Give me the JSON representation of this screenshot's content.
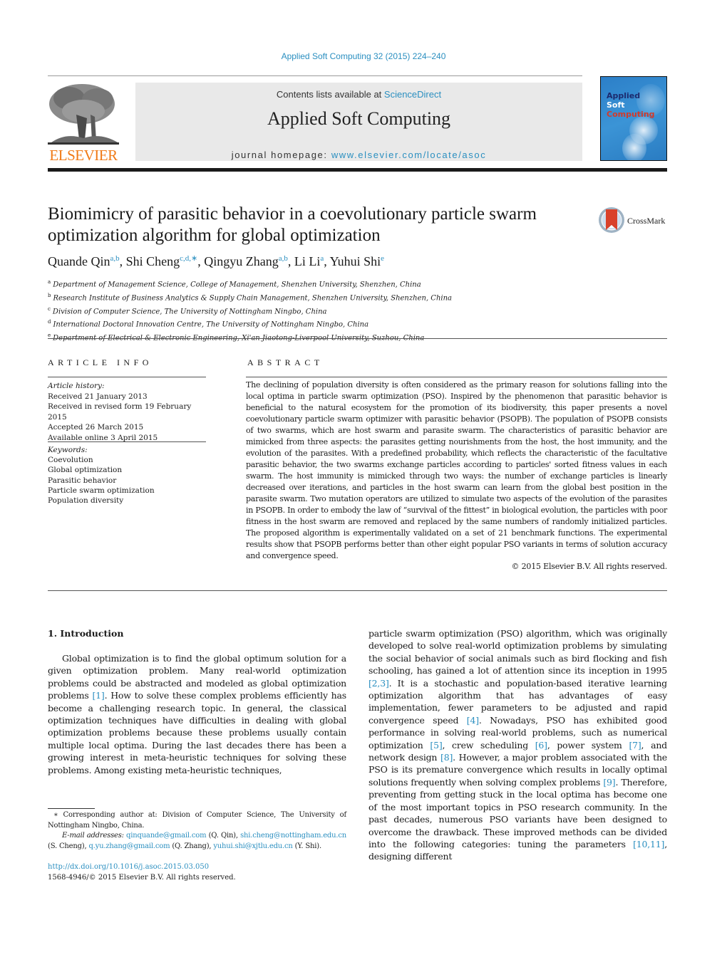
{
  "header": {
    "journal_ref": "Applied Soft Computing 32 (2015) 224–240",
    "contents_prefix": "Contents lists available at ",
    "contents_link": "ScienceDirect",
    "journal_title": "Applied Soft Computing",
    "homepage_prefix": "journal homepage: ",
    "homepage_link": "www.elsevier.com/locate/asoc",
    "publisher_logo_text": "ELSEVIER",
    "cover": {
      "line1": "Applied",
      "line2": "Soft",
      "line3": "Computing",
      "colors": {
        "background": "#3a8fd3",
        "line1": "#1c2a6e",
        "line2": "#ffffff",
        "line3": "#d23a2a"
      }
    }
  },
  "colors": {
    "link": "#2b8fc0",
    "elsevier_orange": "#f07a16",
    "header_box": "#e9e9e9"
  },
  "article": {
    "title": "Biomimicry of parasitic behavior in a coevolutionary particle swarm optimization algorithm for global optimization",
    "crossmark_label": "CrossMark",
    "authors": [
      {
        "name": "Quande Qin",
        "sup": "a,b",
        "sep": ", "
      },
      {
        "name": "Shi Cheng",
        "sup": "c,d,∗",
        "sep": ", "
      },
      {
        "name": "Qingyu Zhang",
        "sup": "a,b",
        "sep": ", "
      },
      {
        "name": "Li Li",
        "sup": "a",
        "sep": ", "
      },
      {
        "name": "Yuhui Shi",
        "sup": "e",
        "sep": ""
      }
    ],
    "affiliations": [
      {
        "key": "a",
        "text": "Department of Management Science, College of Management, Shenzhen University, Shenzhen, China"
      },
      {
        "key": "b",
        "text": "Research Institute of Business Analytics & Supply Chain Management, Shenzhen University, Shenzhen, China"
      },
      {
        "key": "c",
        "text": "Division of Computer Science, The University of Nottingham Ningbo, China"
      },
      {
        "key": "d",
        "text": "International Doctoral Innovation Centre, The University of Nottingham Ningbo, China"
      },
      {
        "key": "e",
        "text": "Department of Electrical & Electronic Engineering, Xi'an Jiaotong-Liverpool University, Suzhou, China"
      }
    ]
  },
  "article_info": {
    "heading": "ARTICLE INFO",
    "history_label": "Article history:",
    "history": [
      "Received 21 January 2013",
      "Received in revised form 19 February 2015",
      "Accepted 26 March 2015",
      "Available online 3 April 2015"
    ],
    "keywords_label": "Keywords:",
    "keywords": [
      "Coevolution",
      "Global optimization",
      "Parasitic behavior",
      "Particle swarm optimization",
      "Population diversity"
    ]
  },
  "abstract": {
    "heading": "ABSTRACT",
    "text": "The declining of population diversity is often considered as the primary reason for solutions falling into the local optima in particle swarm optimization (PSO). Inspired by the phenomenon that parasitic behavior is beneficial to the natural ecosystem for the promotion of its biodiversity, this paper presents a novel coevolutionary particle swarm optimizer with parasitic behavior (PSOPB). The population of PSOPB consists of two swarms, which are host swarm and parasite swarm. The characteristics of parasitic behavior are mimicked from three aspects: the parasites getting nourishments from the host, the host immunity, and the evolution of the parasites. With a predefined probability, which reflects the characteristic of the facultative parasitic behavior, the two swarms exchange particles according to particles' sorted fitness values in each swarm. The host immunity is mimicked through two ways: the number of exchange particles is linearly decreased over iterations, and particles in the host swarm can learn from the global best position in the parasite swarm. Two mutation operators are utilized to simulate two aspects of the evolution of the parasites in PSOPB. In order to embody the law of “survival of the fittest” in biological evolution, the particles with poor fitness in the host swarm are removed and replaced by the same numbers of randomly initialized particles. The proposed algorithm is experimentally validated on a set of 21 benchmark functions. The experimental results show that PSOPB performs better than other eight popular PSO variants in terms of solution accuracy and convergence speed.",
    "copyright": "© 2015 Elsevier B.V. All rights reserved."
  },
  "introduction": {
    "heading": "1.  Introduction",
    "left_segments": [
      {
        "t": "Global optimization is to find the global optimum solution for a given optimization problem. Many real-world optimization problems could be abstracted and modeled as global optimization problems "
      },
      {
        "c": "[1]"
      },
      {
        "t": ". How to solve these complex problems efficiently has become a challenging research topic. In general, the classical optimization techniques have difficulties in dealing with global optimization problems because these problems usually contain multiple local optima. During the last decades there has been a growing interest in meta-heuristic techniques for solving these problems. Among existing meta-heuristic techniques,"
      }
    ],
    "right_segments": [
      {
        "t": "particle swarm optimization (PSO) algorithm, which was originally developed to solve real-world optimization problems by simulating the social behavior of social animals such as bird flocking and fish schooling, has gained a lot of attention since its inception in 1995 "
      },
      {
        "c": "[2,3]"
      },
      {
        "t": ". It is a stochastic and population-based iterative learning optimization algorithm that has advantages of easy implementation, fewer parameters to be adjusted and rapid convergence speed "
      },
      {
        "c": "[4]"
      },
      {
        "t": ". Nowadays, PSO has exhibited good performance in solving real-world problems, such as numerical optimization "
      },
      {
        "c": "[5]"
      },
      {
        "t": ", crew scheduling "
      },
      {
        "c": "[6]"
      },
      {
        "t": ", power system "
      },
      {
        "c": "[7]"
      },
      {
        "t": ", and network design "
      },
      {
        "c": "[8]"
      },
      {
        "t": ". However, a major problem associated with the PSO is its premature convergence which results in locally optimal solutions frequently when solving complex problems "
      },
      {
        "c": "[9]"
      },
      {
        "t": ". Therefore, preventing from getting stuck in the local optima has become one of the most important topics in PSO research community. In the past decades, numerous PSO variants have been designed to overcome the drawback. These improved methods can be divided into the following categories: tuning the parameters "
      },
      {
        "c": "[10,11]"
      },
      {
        "t": ", designing different"
      }
    ]
  },
  "footnotes": {
    "corresponding": "∗  Corresponding author at: Division of Computer Science, The University of Nottingham Ningbo, China.",
    "email_label": "E-mail addresses:",
    "emails": [
      {
        "addr": "qinquande@gmail.com",
        "who": " (Q. Qin), "
      },
      {
        "addr": "shi.cheng@nottingham.edu.cn",
        "who": " (S. Cheng), "
      },
      {
        "addr": "q.yu.zhang@gmail.com",
        "who": " (Q. Zhang), "
      },
      {
        "addr": "yuhui.shi@xjtlu.edu.cn",
        "who": " (Y. Shi)."
      }
    ],
    "doi": "http://dx.doi.org/10.1016/j.asoc.2015.03.050",
    "issn": "1568-4946/© 2015 Elsevier B.V. All rights reserved."
  }
}
